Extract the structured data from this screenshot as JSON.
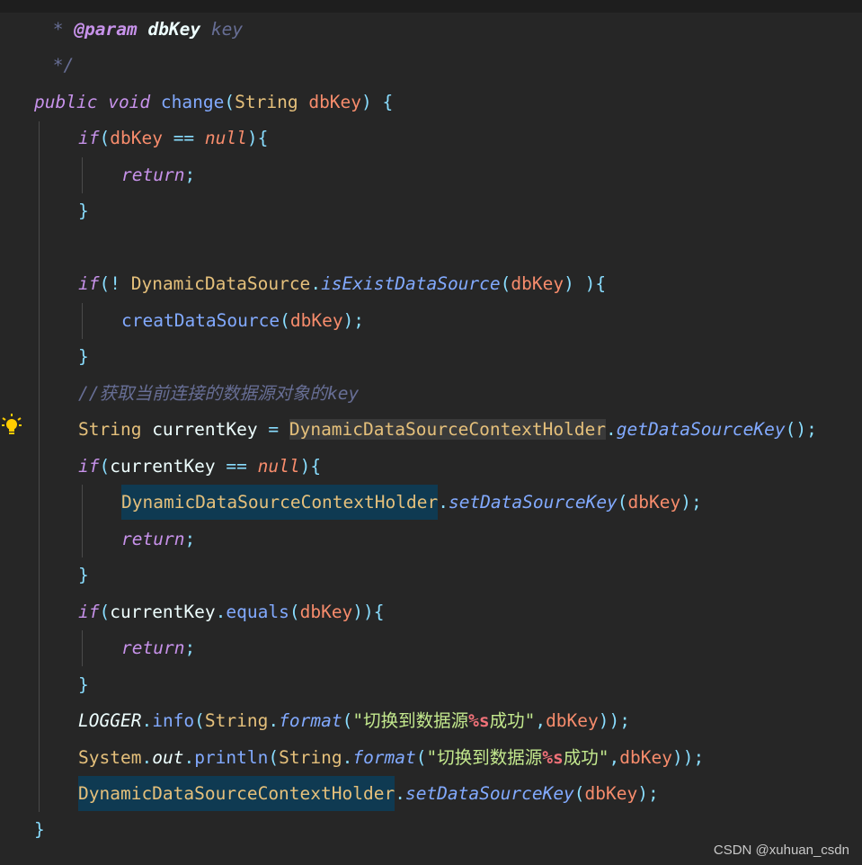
{
  "editor": {
    "language": "java",
    "theme_colors": {
      "background": "#262626",
      "keyword": "#c792ea",
      "type": "#e5c07b",
      "function": "#82aaff",
      "parameter": "#f78c6c",
      "string": "#c3e88d",
      "comment": "#676e95",
      "reference_highlight": "#0f3a52"
    },
    "gutter_icon": "lightbulb-icon",
    "lines": [
      {
        "tokens": [
          [
            "cmt",
            " * "
          ],
          [
            "doc-tag",
            "@param"
          ],
          [
            "cmt",
            " "
          ],
          [
            "doc-name",
            "dbKey"
          ],
          [
            "cmt",
            " key"
          ]
        ]
      },
      {
        "tokens": [
          [
            "cmt",
            " */"
          ]
        ]
      },
      {
        "tokens": [
          [
            "kw",
            "public"
          ],
          [
            "var",
            " "
          ],
          [
            "kw",
            "void"
          ],
          [
            "var",
            " "
          ],
          [
            "fn",
            "change"
          ],
          [
            "punc",
            "("
          ],
          [
            "type",
            "String"
          ],
          [
            "var",
            " "
          ],
          [
            "param",
            "dbKey"
          ],
          [
            "punc",
            ")"
          ],
          [
            "var",
            " "
          ],
          [
            "punc",
            "{"
          ]
        ]
      },
      {
        "tokens": [
          [
            "kw",
            "if"
          ],
          [
            "punc",
            "("
          ],
          [
            "param",
            "dbKey"
          ],
          [
            "var",
            " "
          ],
          [
            "op",
            "=="
          ],
          [
            "var",
            " "
          ],
          [
            "null",
            "null"
          ],
          [
            "punc",
            "){"
          ]
        ]
      },
      {
        "tokens": [
          [
            "kw",
            "return"
          ],
          [
            "punc",
            ";"
          ]
        ]
      },
      {
        "tokens": [
          [
            "punc",
            "}"
          ]
        ]
      },
      {
        "tokens": []
      },
      {
        "tokens": [
          [
            "kw",
            "if"
          ],
          [
            "punc",
            "(!"
          ],
          [
            "var",
            " "
          ],
          [
            "cls",
            "DynamicDataSource"
          ],
          [
            "punc",
            "."
          ],
          [
            "fn-i",
            "isExistDataSource"
          ],
          [
            "punc",
            "("
          ],
          [
            "param",
            "dbKey"
          ],
          [
            "punc",
            ")"
          ],
          [
            "var",
            " "
          ],
          [
            "punc",
            "){"
          ]
        ]
      },
      {
        "tokens": [
          [
            "fn",
            "creatDataSource"
          ],
          [
            "punc",
            "("
          ],
          [
            "param",
            "dbKey"
          ],
          [
            "punc",
            ");"
          ]
        ]
      },
      {
        "tokens": [
          [
            "punc",
            "}"
          ]
        ]
      },
      {
        "tokens": [
          [
            "cmt",
            "//获取当前连接的数据源对象的key"
          ]
        ]
      },
      {
        "tokens": [
          [
            "type",
            "String"
          ],
          [
            "var",
            " currentKey "
          ],
          [
            "op",
            "="
          ],
          [
            "var",
            " "
          ],
          [
            "sel",
            "DynamicDataSourceContextHolder"
          ],
          [
            "punc",
            "."
          ],
          [
            "fn-i",
            "getDataSourceKey"
          ],
          [
            "punc",
            "();"
          ]
        ]
      },
      {
        "tokens": [
          [
            "kw",
            "if"
          ],
          [
            "punc",
            "("
          ],
          [
            "var",
            "currentKey"
          ],
          [
            "var",
            " "
          ],
          [
            "op",
            "=="
          ],
          [
            "var",
            " "
          ],
          [
            "null",
            "null"
          ],
          [
            "punc",
            "){"
          ]
        ]
      },
      {
        "tokens": [
          [
            "ref",
            "DynamicDataSourceContextHolder"
          ],
          [
            "punc",
            "."
          ],
          [
            "fn-i",
            "setDataSourceKey"
          ],
          [
            "punc",
            "("
          ],
          [
            "param",
            "dbKey"
          ],
          [
            "punc",
            ");"
          ]
        ]
      },
      {
        "tokens": [
          [
            "kw",
            "return"
          ],
          [
            "punc",
            ";"
          ]
        ]
      },
      {
        "tokens": [
          [
            "punc",
            "}"
          ]
        ]
      },
      {
        "tokens": [
          [
            "kw",
            "if"
          ],
          [
            "punc",
            "("
          ],
          [
            "var",
            "currentKey"
          ],
          [
            "punc",
            "."
          ],
          [
            "fn",
            "equals"
          ],
          [
            "punc",
            "("
          ],
          [
            "param",
            "dbKey"
          ],
          [
            "punc",
            "))"
          ],
          [
            "punc",
            "{"
          ]
        ]
      },
      {
        "tokens": [
          [
            "kw",
            "return"
          ],
          [
            "punc",
            ";"
          ]
        ]
      },
      {
        "tokens": [
          [
            "punc",
            "}"
          ]
        ]
      },
      {
        "tokens": [
          [
            "static-f",
            "LOGGER"
          ],
          [
            "punc",
            "."
          ],
          [
            "fn",
            "info"
          ],
          [
            "punc",
            "("
          ],
          [
            "type",
            "String"
          ],
          [
            "punc",
            "."
          ],
          [
            "fn-i",
            "format"
          ],
          [
            "punc",
            "("
          ],
          [
            "str",
            "\"切换到数据源"
          ],
          [
            "fmt",
            "%s"
          ],
          [
            "str",
            "成功\""
          ],
          [
            "punc",
            ","
          ],
          [
            "param",
            "dbKey"
          ],
          [
            "punc",
            "));"
          ]
        ]
      },
      {
        "tokens": [
          [
            "type",
            "System"
          ],
          [
            "punc",
            "."
          ],
          [
            "static-f",
            "out"
          ],
          [
            "punc",
            "."
          ],
          [
            "fn",
            "println"
          ],
          [
            "punc",
            "("
          ],
          [
            "type",
            "String"
          ],
          [
            "punc",
            "."
          ],
          [
            "fn-i",
            "format"
          ],
          [
            "punc",
            "("
          ],
          [
            "str",
            "\"切换到数据源"
          ],
          [
            "fmt",
            "%s"
          ],
          [
            "str",
            "成功\""
          ],
          [
            "punc",
            ","
          ],
          [
            "param",
            "dbKey"
          ],
          [
            "punc",
            "));"
          ]
        ]
      },
      {
        "tokens": [
          [
            "ref",
            "DynamicDataSourceContextHolder"
          ],
          [
            "punc",
            "."
          ],
          [
            "fn-i",
            "setDataSourceKey"
          ],
          [
            "punc",
            "("
          ],
          [
            "param",
            "dbKey"
          ],
          [
            "punc",
            ");"
          ]
        ]
      },
      {
        "tokens": [
          [
            "punc",
            "}"
          ]
        ]
      }
    ]
  },
  "watermark": "CSDN @xuhuan_csdn"
}
